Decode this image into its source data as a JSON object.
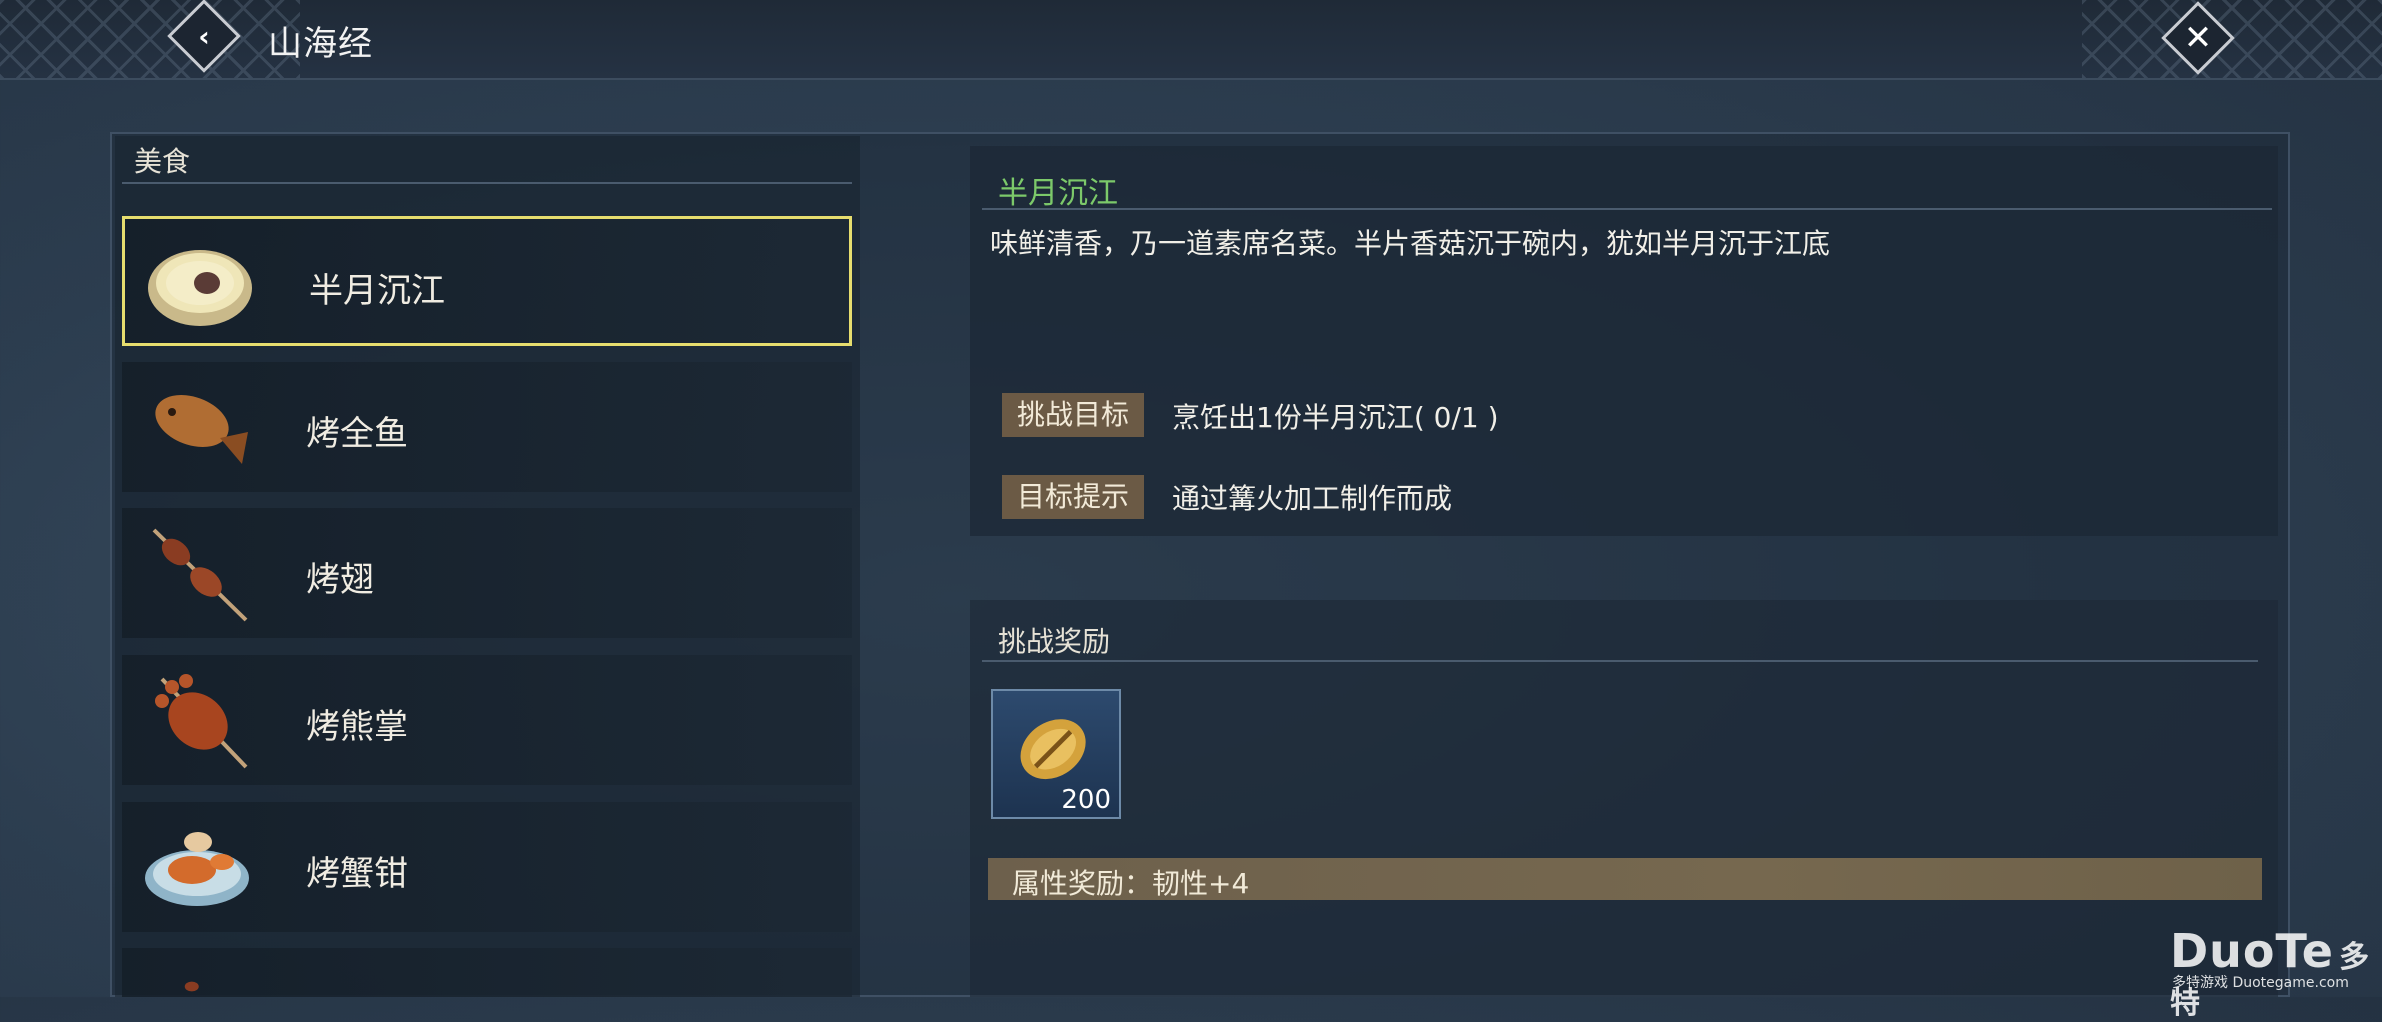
{
  "header": {
    "title": "山海经",
    "back_icon": "chevron-left-icon",
    "close_icon": "close-x-icon"
  },
  "category": {
    "title": "美食"
  },
  "food_list": [
    {
      "label": "半月沉江",
      "icon": "soup-bowl-icon",
      "selected": true
    },
    {
      "label": "烤全鱼",
      "icon": "roast-fish-icon",
      "selected": false
    },
    {
      "label": "烤翅",
      "icon": "skewer-wings-icon",
      "selected": false
    },
    {
      "label": "烤熊掌",
      "icon": "roast-paw-icon",
      "selected": false
    },
    {
      "label": "烤蟹钳",
      "icon": "crab-plate-icon",
      "selected": false
    },
    {
      "label": "",
      "icon": "skewer-icon",
      "selected": false
    }
  ],
  "detail": {
    "name": "半月沉江",
    "description": "味鲜清香，乃一道素席名菜。半片香菇沉于碗内，犹如半月沉于江底",
    "goal_tag": "挑战目标",
    "goal_text": "烹饪出1份半月沉江( 0/1 )",
    "hint_tag": "目标提示",
    "hint_text": "通过篝火加工制作而成"
  },
  "reward": {
    "title": "挑战奖励",
    "item_icon": "gold-shell-icon",
    "item_count": "200",
    "attribute": "属性奖励：韧性+4"
  },
  "watermark": {
    "brand": "DuoTe",
    "brand_cn": "多特",
    "sub": "多特游戏 Duotegame.com"
  }
}
